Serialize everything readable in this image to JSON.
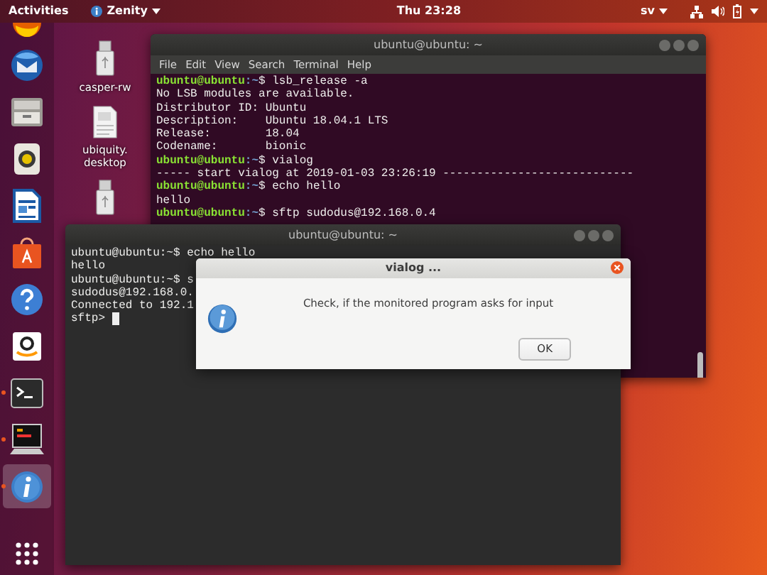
{
  "top_bar": {
    "activities": "Activities",
    "app_menu": "Zenity",
    "clock": "Thu 23:28",
    "keyboard_layout": "sv"
  },
  "dock": {
    "items": [
      {
        "running": false,
        "selected": false
      },
      {
        "running": false,
        "selected": false
      },
      {
        "running": false,
        "selected": false
      },
      {
        "running": false,
        "selected": false
      },
      {
        "running": false,
        "selected": false
      },
      {
        "running": false,
        "selected": false
      },
      {
        "running": false,
        "selected": false
      },
      {
        "running": false,
        "selected": false
      },
      {
        "running": true,
        "selected": false
      },
      {
        "running": true,
        "selected": false
      },
      {
        "running": true,
        "selected": true
      }
    ]
  },
  "desktop_icons": [
    {
      "kind": "drive",
      "label": "casper-rw"
    },
    {
      "kind": "document",
      "label": "ubiquity.\ndesktop"
    },
    {
      "kind": "drive"
    }
  ],
  "terminals": [
    {
      "title": "ubuntu@ubuntu: ~",
      "menu": [
        "File",
        "Edit",
        "View",
        "Search",
        "Terminal",
        "Help"
      ],
      "lines": [
        {
          "kind": "prompt",
          "user": "ubuntu@ubuntu",
          "path": ":~",
          "command": "$ lsb_release -a"
        },
        {
          "kind": "output",
          "text": "No LSB modules are available."
        },
        {
          "kind": "output",
          "text": "Distributor ID: Ubuntu"
        },
        {
          "kind": "output",
          "text": "Description:    Ubuntu 18.04.1 LTS"
        },
        {
          "kind": "output",
          "text": "Release:        18.04"
        },
        {
          "kind": "output",
          "text": "Codename:       bionic"
        },
        {
          "kind": "prompt",
          "user": "ubuntu@ubuntu",
          "path": ":~",
          "command": "$ vialog"
        },
        {
          "kind": "output",
          "text": "----- start vialog at 2019-01-03 23:26:19 ----------------------------"
        },
        {
          "kind": "prompt",
          "user": "ubuntu@ubuntu",
          "path": ":~",
          "command": "$ echo hello"
        },
        {
          "kind": "output",
          "text": "hello"
        },
        {
          "kind": "prompt",
          "user": "ubuntu@ubuntu",
          "path": ":~",
          "command": "$ sftp sudodus@192.168.0.4"
        }
      ]
    },
    {
      "title": "ubuntu@ubuntu: ~",
      "lines": [
        {
          "kind": "output",
          "text": "ubuntu@ubuntu:~$ echo hello"
        },
        {
          "kind": "output",
          "text": "hello"
        },
        {
          "kind": "output",
          "text": "ubuntu@ubuntu:~$ s"
        },
        {
          "kind": "output",
          "text": "sudodus@192.168.0."
        },
        {
          "kind": "output",
          "text": "Connected to 192.1"
        },
        {
          "kind": "output",
          "text": "sftp> ",
          "cursor": true
        }
      ]
    }
  ],
  "dialog": {
    "title": "vialog  ...",
    "message": "Check, if the monitored program asks for input",
    "button": "OK"
  }
}
